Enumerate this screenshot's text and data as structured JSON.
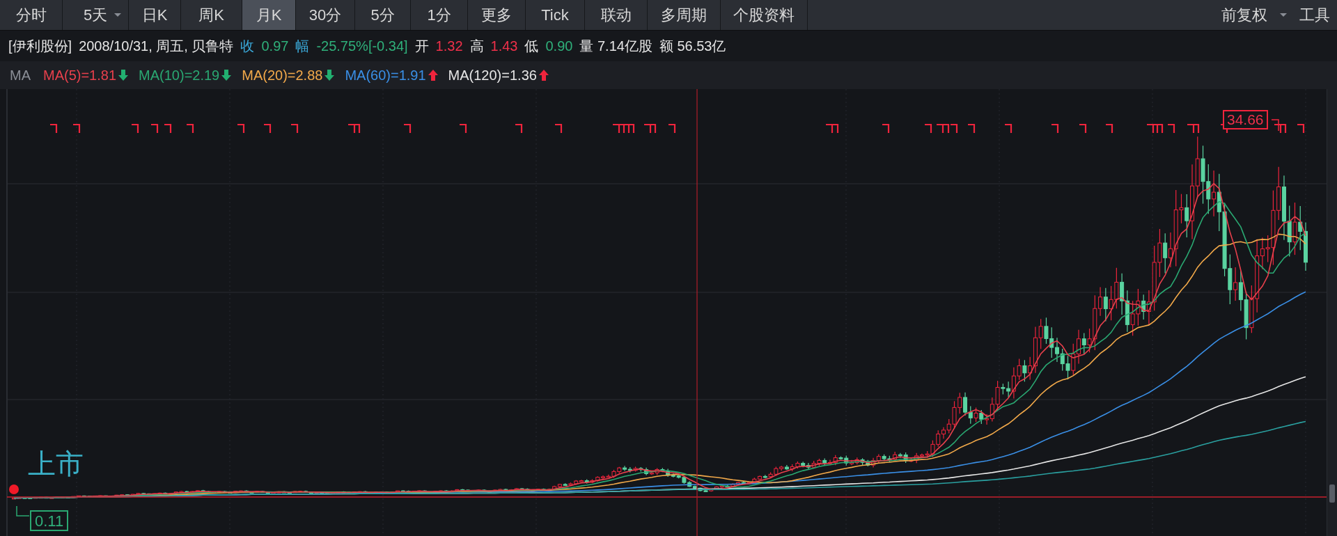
{
  "toolbar": {
    "tabs": [
      {
        "label": "分时",
        "selected": false,
        "dropdown": false
      },
      {
        "label": "5天",
        "selected": false,
        "dropdown": true
      },
      {
        "label": "日K",
        "selected": false,
        "dropdown": false
      },
      {
        "label": "周K",
        "selected": false,
        "dropdown": false
      },
      {
        "label": "月K",
        "selected": true,
        "dropdown": false
      },
      {
        "label": "30分",
        "selected": false,
        "dropdown": false
      },
      {
        "label": "5分",
        "selected": false,
        "dropdown": false
      },
      {
        "label": "1分",
        "selected": false,
        "dropdown": false
      },
      {
        "label": "更多",
        "selected": false,
        "dropdown": false
      },
      {
        "label": "Tick",
        "selected": false,
        "dropdown": false
      },
      {
        "label": "联动",
        "selected": false,
        "dropdown": false
      },
      {
        "label": "多周期",
        "selected": false,
        "dropdown": false
      },
      {
        "label": "个股资料",
        "selected": false,
        "dropdown": false
      }
    ],
    "right": [
      {
        "label": "前复权",
        "dropdown": true
      },
      {
        "label": "工具",
        "dropdown": false
      }
    ]
  },
  "info": [
    {
      "text": "[伊利股份]",
      "color": "#e6e6e6"
    },
    {
      "text": "2008/10/31, 周五, 贝鲁特",
      "color": "#e6e6e6"
    },
    {
      "text": "收",
      "color": "#3aa8d8"
    },
    {
      "text": "0.97",
      "color": "#2fb07a"
    },
    {
      "text": "幅",
      "color": "#3aa8d8"
    },
    {
      "text": "-25.75%[-0.34]",
      "color": "#2fb07a"
    },
    {
      "text": "开",
      "color": "#e6e6e6"
    },
    {
      "text": "1.32",
      "color": "#f0304a"
    },
    {
      "text": "高",
      "color": "#e6e6e6"
    },
    {
      "text": "1.43",
      "color": "#f0304a"
    },
    {
      "text": "低",
      "color": "#e6e6e6"
    },
    {
      "text": "0.90",
      "color": "#2fb07a"
    },
    {
      "text": "量 7.14亿股",
      "color": "#e6e6e6"
    },
    {
      "text": "额 56.53亿",
      "color": "#e6e6e6"
    }
  ],
  "ma_bar": {
    "label": "MA",
    "items": [
      {
        "text": "MA(5)=1.81",
        "color": "#e8404c",
        "rising": false
      },
      {
        "text": "MA(10)=2.19",
        "color": "#2aa872",
        "rising": false
      },
      {
        "text": "MA(20)=2.88",
        "color": "#f2a94a",
        "rising": false
      },
      {
        "text": "MA(60)=1.91",
        "color": "#3a8fe6",
        "rising": true
      },
      {
        "text": "MA(120)=1.36",
        "color": "#e6e6e6",
        "rising": true
      }
    ]
  },
  "chart": {
    "listing_label": "上市",
    "low_label": "0.11",
    "high_label": "34.66"
  }
}
